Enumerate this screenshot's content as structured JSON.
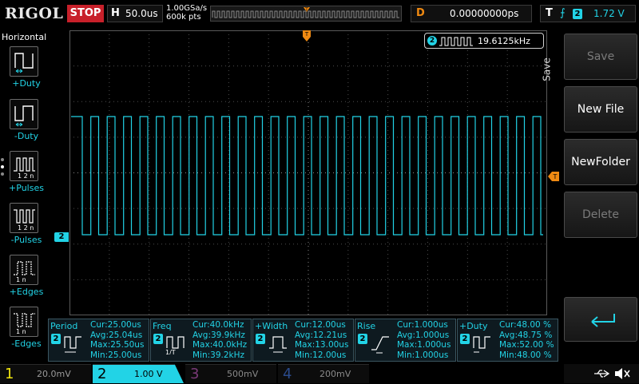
{
  "top": {
    "brand": "RIGOL",
    "run_state": "STOP",
    "horizontal_label": "H",
    "horizontal_scale": "50.0us",
    "sample_rate": "1.00GSa/s",
    "memory_depth": "600k pts",
    "delay_label": "D",
    "delay_value": "0.00000000ps",
    "trigger_label": "T",
    "trigger_icon": "rising-edge-icon",
    "trigger_channel": "2",
    "trigger_level": "1.72 V"
  },
  "left_menu": {
    "title": "Horizontal",
    "items": [
      {
        "label": "+Duty",
        "icon": "positive-duty-icon"
      },
      {
        "label": "-Duty",
        "icon": "negative-duty-icon"
      },
      {
        "label": "+Pulses",
        "icon": "positive-pulses-icon"
      },
      {
        "label": "-Pulses",
        "icon": "negative-pulses-icon"
      },
      {
        "label": "+Edges",
        "icon": "positive-edges-icon"
      },
      {
        "label": "-Edges",
        "icon": "negative-edges-icon"
      }
    ]
  },
  "screen": {
    "freq_counter_channel": "2",
    "freq_counter_value": "19.6125kHz",
    "channel_marker": "2",
    "trace_color": "#22d3e6",
    "duty": 0.48
  },
  "right_menu": {
    "side_label": "Save",
    "buttons": [
      {
        "label": "Save",
        "enabled": false
      },
      {
        "label": "New File",
        "enabled": true
      },
      {
        "label": "NewFolder",
        "enabled": true
      },
      {
        "label": "Delete",
        "enabled": false
      }
    ],
    "enter_icon": "enter-arrow-icon"
  },
  "measurements": [
    {
      "name": "Period",
      "channel": "2",
      "cur": "Cur:25.00us",
      "avg": "Avg:25.04us",
      "max": "Max:25.50us",
      "min": "Min:25.00us",
      "icon": "period-icon"
    },
    {
      "name": "Freq",
      "channel": "2",
      "cur": "Cur:40.0kHz",
      "avg": "Avg:39.9kHz",
      "max": "Max:40.0kHz",
      "min": "Min:39.2kHz",
      "icon": "frequency-icon"
    },
    {
      "name": "+Width",
      "channel": "2",
      "cur": "Cur:12.00us",
      "avg": "Avg:12.21us",
      "max": "Max:13.00us",
      "min": "Min:12.00us",
      "icon": "positive-width-icon"
    },
    {
      "name": "Rise",
      "channel": "2",
      "cur": "Cur:1.000us",
      "avg": "Avg:1.000us",
      "max": "Max:1.000us",
      "min": "Min:1.000us",
      "icon": "rise-time-icon"
    },
    {
      "name": "+Duty",
      "channel": "2",
      "cur": "Cur:48.00 %",
      "avg": "Avg:48.75 %",
      "max": "Max:52.00 %",
      "min": "Min:48.00 %",
      "icon": "positive-duty-icon"
    }
  ],
  "channels": [
    {
      "num": "1",
      "scale": "20.0mV",
      "color": "#f2e60f"
    },
    {
      "num": "2",
      "scale": "1.00 V",
      "color": "#22d3e6"
    },
    {
      "num": "3",
      "scale": "500mV",
      "color": "#e14bd4"
    },
    {
      "num": "4",
      "scale": "200mV",
      "color": "#2a6ad9"
    }
  ],
  "status_icons": [
    "usb-icon",
    "speaker-muted-icon"
  ]
}
